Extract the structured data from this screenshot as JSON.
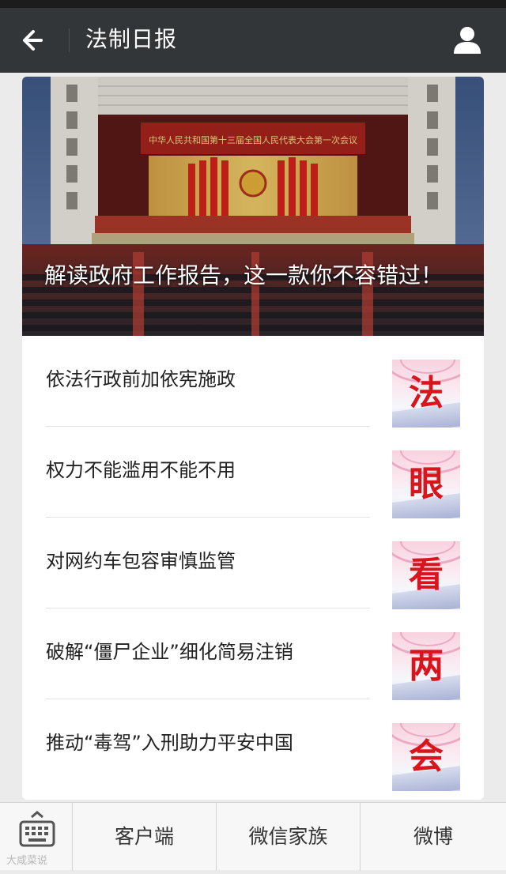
{
  "navbar": {
    "title": "法制日报",
    "back_icon": "back-arrow-icon",
    "profile_icon": "person-icon"
  },
  "hero": {
    "caption": "解读政府工作报告，这一款你不容错过！",
    "banner_text": "中华人民共和国第十三届全国人民代表大会第一次会议"
  },
  "news": [
    {
      "title": "依法行政前加依宪施政",
      "thumb_char": "法"
    },
    {
      "title": "权力不能滥用不能不用",
      "thumb_char": "眼"
    },
    {
      "title": "对网约车包容审慎监管",
      "thumb_char": "看"
    },
    {
      "title": "破解“僵尸企业”细化简易注销",
      "thumb_char": "两"
    },
    {
      "title": "推动“毒驾”入刑助力平安中国",
      "thumb_char": "会"
    }
  ],
  "bottom_menu": {
    "keyboard_icon": "keyboard-icon",
    "items": [
      {
        "label": "客户端"
      },
      {
        "label": "微信家族"
      },
      {
        "label": "微博"
      }
    ]
  },
  "watermark": "大咸菜说",
  "colors": {
    "navbar_bg": "#333638",
    "thumb_red": "#d8141c",
    "page_bg": "#ebebeb"
  }
}
